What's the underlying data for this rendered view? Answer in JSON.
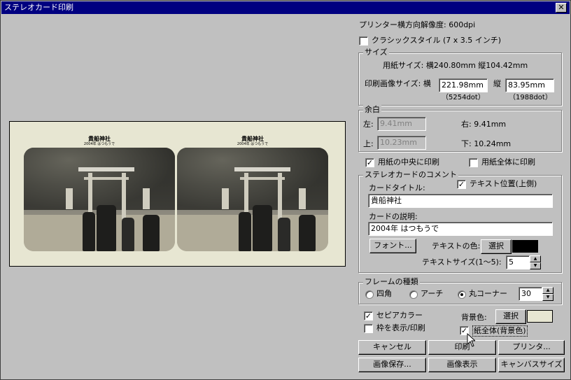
{
  "window": {
    "title": "ステレオカード印刷",
    "close_label": "✕"
  },
  "printer_resolution": "プリンター横方向解像度: 600dpi",
  "classic_style": {
    "label": "クラシックスタイル (7 x 3.5 インチ)",
    "checked": false
  },
  "size": {
    "group_label": "サイズ",
    "paper_size": "用紙サイズ: 横240.80mm 縦104.42mm",
    "image_size_label": "印刷画像サイズ: 横",
    "width_value": "221.98mm",
    "height_label": "縦",
    "height_value": "83.95mm",
    "width_dots": "（5254dot）",
    "height_dots": "（1988dot）"
  },
  "margin": {
    "group_label": "余白",
    "left_label": "左:",
    "left_value": "9.41mm",
    "top_label": "上:",
    "top_value": "10.23mm",
    "right_text": "右: 9.41mm",
    "bottom_text": "下: 10.24mm"
  },
  "center_print": {
    "label": "用紙の中央に印刷",
    "checked": true
  },
  "full_print": {
    "label": "用紙全体に印刷",
    "checked": false
  },
  "comment": {
    "group_label": "ステレオカードのコメント",
    "title_label": "カードタイトル:",
    "text_position": {
      "label": "テキスト位置(上側)",
      "checked": true
    },
    "title_value": "貴船神社",
    "desc_label": "カードの説明:",
    "desc_value": "2004年 はつもうで",
    "font_button": "フォント...",
    "text_color_label": "テキストの色:",
    "text_color_button": "選択",
    "text_color": "#000000",
    "text_size_label": "テキストサイズ(1〜5):",
    "text_size_value": "5"
  },
  "frame": {
    "group_label": "フレームの種類",
    "options": [
      "四角",
      "アーチ",
      "丸コーナー"
    ],
    "selected": "丸コーナー",
    "radius_value": "30"
  },
  "sepia": {
    "label": "セピアカラー",
    "checked": true
  },
  "show_frame": {
    "label": "枠を表示/印刷",
    "checked": false
  },
  "background": {
    "label": "背景色:",
    "button": "選択",
    "color": "#e7e6d2",
    "whole_paper": {
      "label": "紙全体(背景色)",
      "checked": true
    }
  },
  "buttons": {
    "cancel": "キャンセル",
    "print": "印刷",
    "printer": "プリンタ...",
    "save_image": "画像保存...",
    "show_image": "画像表示",
    "canvas_size": "キャンバスサイズ"
  },
  "preview": {
    "card_title": "貴船神社",
    "card_desc": "2004年 はつもうで"
  },
  "icons": {
    "checkmark": "✓",
    "spin_up": "▲",
    "spin_down": "▼"
  }
}
